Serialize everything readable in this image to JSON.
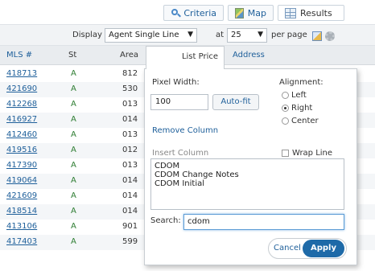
{
  "tabs": {
    "criteria": "Criteria",
    "map": "Map",
    "results": "Results"
  },
  "display_bar": {
    "display_label": "Display",
    "display_value": "Agent Single Line",
    "at_label": "at",
    "per_page_value": "25",
    "per_page_label": "per page",
    "arrow": "▼"
  },
  "columns": {
    "mls": "MLS #",
    "st": "St",
    "area": "Area",
    "list_price": "List Price",
    "address": "Address"
  },
  "rows": [
    {
      "mls": "418713",
      "st": "A",
      "area": "812"
    },
    {
      "mls": "421690",
      "st": "A",
      "area": "530"
    },
    {
      "mls": "412268",
      "st": "A",
      "area": "013"
    },
    {
      "mls": "416927",
      "st": "A",
      "area": "014"
    },
    {
      "mls": "412460",
      "st": "A",
      "area": "013"
    },
    {
      "mls": "419516",
      "st": "A",
      "area": "012"
    },
    {
      "mls": "417390",
      "st": "A",
      "area": "013"
    },
    {
      "mls": "419064",
      "st": "A",
      "area": "014"
    },
    {
      "mls": "421609",
      "st": "A",
      "area": "014"
    },
    {
      "mls": "418514",
      "st": "A",
      "area": "014"
    },
    {
      "mls": "413106",
      "st": "A",
      "area": "901"
    },
    {
      "mls": "417403",
      "st": "A",
      "area": "599"
    }
  ],
  "popup": {
    "pixel_width_label": "Pixel Width:",
    "pixel_width_value": "100",
    "autofit_label": "Auto-fit",
    "alignment_label": "Alignment:",
    "align_left": "Left",
    "align_right": "Right",
    "align_center": "Center",
    "selected_alignment": "Right",
    "remove_column": "Remove Column",
    "insert_column_label": "Insert Column",
    "wrap_line_label": "Wrap Line",
    "insert_options": [
      "CDOM",
      "CDOM Change Notes",
      "CDOM Initial"
    ],
    "search_label": "Search:",
    "search_value": "cdom",
    "cancel_label": "Cancel",
    "apply_label": "Apply"
  }
}
